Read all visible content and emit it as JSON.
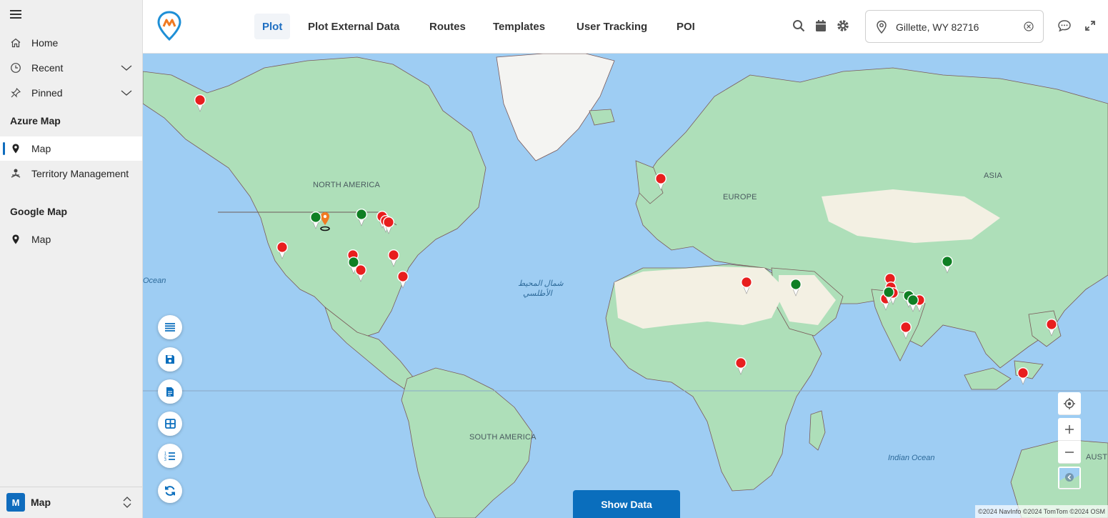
{
  "sidebar": {
    "items": [
      {
        "label": "Home",
        "icon": "home-icon"
      },
      {
        "label": "Recent",
        "icon": "clock-icon"
      },
      {
        "label": "Pinned",
        "icon": "pin-icon"
      }
    ],
    "groups": [
      {
        "title": "Azure Map",
        "items": [
          {
            "label": "Map",
            "icon": "map-pin-icon",
            "active": true
          },
          {
            "label": "Territory Management",
            "icon": "territory-icon"
          }
        ]
      },
      {
        "title": "Google Map",
        "items": [
          {
            "label": "Map",
            "icon": "map-pin-icon"
          }
        ]
      }
    ],
    "area": {
      "badge": "M",
      "label": "Map"
    }
  },
  "header": {
    "tabs": [
      "Plot",
      "Plot External Data",
      "Routes",
      "Templates",
      "User Tracking",
      "POI"
    ],
    "active_tab": "Plot",
    "search": {
      "value": "Gillette, WY 82716"
    }
  },
  "map": {
    "labels": {
      "north_america": "NORTH AMERICA",
      "europe": "EUROPE",
      "asia": "ASIA",
      "south_america": "SOUTH AMERICA",
      "austria": "AUST",
      "ocean_left": "Ocean",
      "atlantic_ar_1": "شمال المحيط",
      "atlantic_ar_2": "الأطلسي",
      "indian_ocean": "Indian Ocean"
    },
    "show_data_label": "Show Data",
    "attribution": "©2024 NavInfo ©2024 TomTom ©2024 OSM",
    "colors": {
      "water": "#9ecdf3",
      "land": "#aedfb9",
      "desert": "#f3f0e3",
      "marker_red": "#e81e1e",
      "marker_green": "#0f7f24",
      "marker_orange": "#f07a22",
      "accent": "#0a6ebd"
    }
  }
}
